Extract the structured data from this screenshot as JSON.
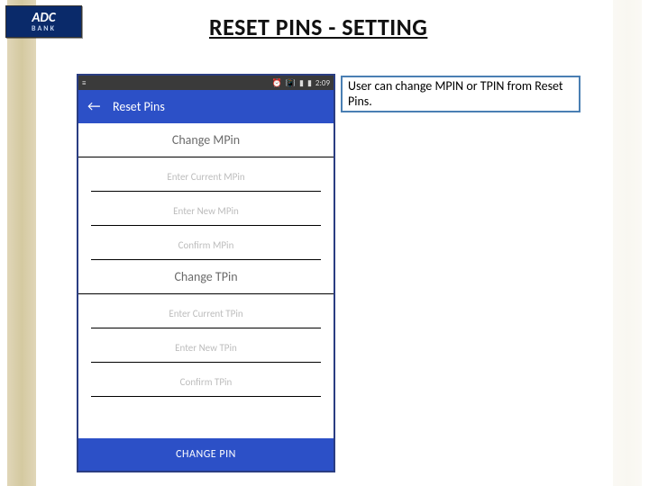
{
  "logo": {
    "top": "ADC",
    "bottom": "BANK"
  },
  "slide_title": "RESET PINS - SETTING",
  "callout_text": "User can change MPIN or TPIN from Reset Pins.",
  "statusbar": {
    "time": "2:09"
  },
  "appbar": {
    "title": "Reset Pins"
  },
  "sections": {
    "mpin": {
      "header": "Change MPin",
      "fields": [
        "Enter Current MPin",
        "Enter New MPin",
        "Confirm MPin"
      ]
    },
    "tpin": {
      "header": "Change TPin",
      "fields": [
        "Enter Current TPin",
        "Enter New TPin",
        "Confirm TPin"
      ]
    }
  },
  "change_button": "CHANGE PIN"
}
